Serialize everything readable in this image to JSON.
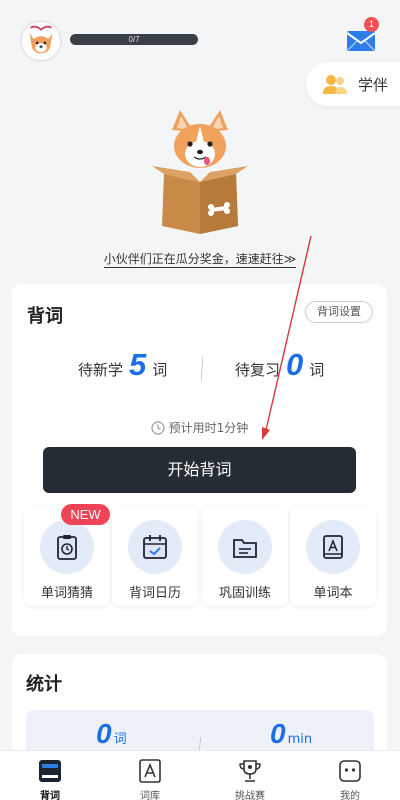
{
  "header": {
    "progress": {
      "label": "0/7",
      "fraction": 0
    },
    "mail_badge": "1",
    "companion_label": "学伴"
  },
  "banner_link": "小伙伴们正在瓜分奖金，速速赶往≫",
  "study_card": {
    "title": "背词",
    "settings_label": "背词设置",
    "new_label": "待新学",
    "new_count": "5",
    "review_label": "待复习",
    "review_count": "0",
    "unit": "词",
    "estimate": "预计用时1分钟",
    "start_label": "开始背词",
    "new_badge": "NEW",
    "tools": [
      {
        "label": "单词猜猜",
        "icon": "clipboard-clock-icon"
      },
      {
        "label": "背词日历",
        "icon": "calendar-check-icon"
      },
      {
        "label": "巩固训练",
        "icon": "folder-icon"
      },
      {
        "label": "单词本",
        "icon": "book-letter-icon"
      }
    ]
  },
  "stats_card": {
    "title": "统计",
    "words_count": "0",
    "words_unit": "词",
    "minutes_count": "0",
    "minutes_unit": "min"
  },
  "tabbar": {
    "tabs": [
      {
        "label": "背词",
        "icon": "book-tab-icon",
        "active": true
      },
      {
        "label": "词库",
        "icon": "letter-a-icon",
        "active": false
      },
      {
        "label": "挑战赛",
        "icon": "trophy-icon",
        "active": false
      },
      {
        "label": "我的",
        "icon": "face-icon",
        "active": false
      }
    ]
  },
  "colors": {
    "accent": "#1a6ee8",
    "dark_button": "#262c33",
    "badge_red": "#ee4455",
    "annotation_arrow": "#d63a3a"
  }
}
